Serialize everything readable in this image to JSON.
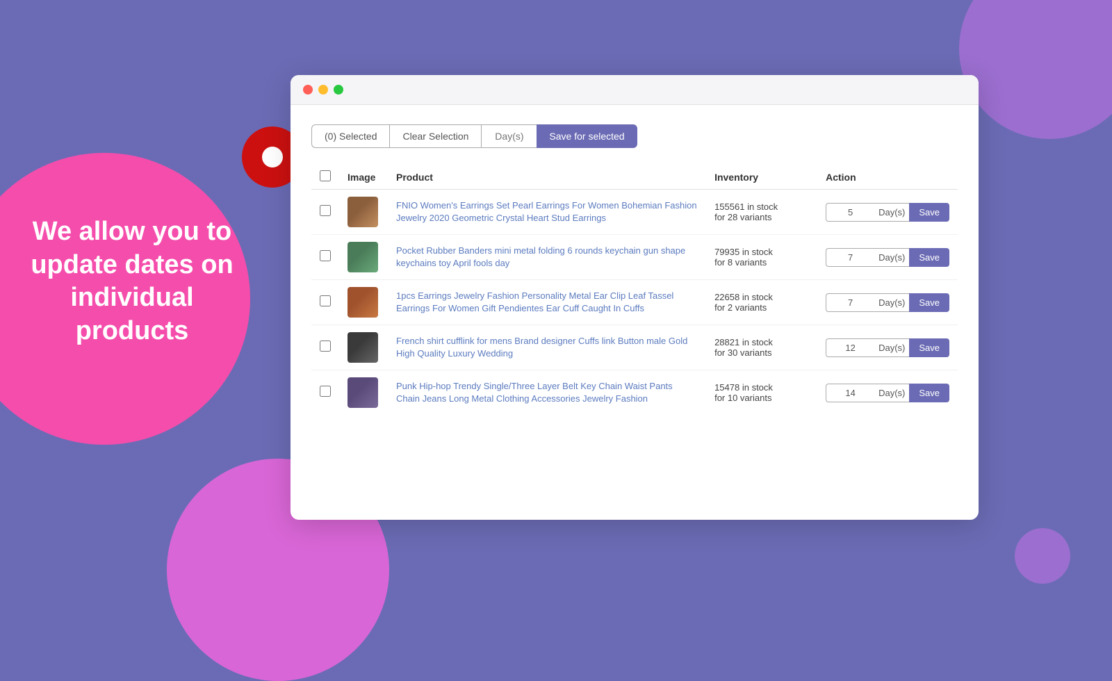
{
  "background": {
    "color": "#6b6bb5"
  },
  "left_text": "We allow you to update dates on individual products",
  "toolbar": {
    "selected_label": "(0) Selected",
    "clear_label": "Clear Selection",
    "days_placeholder": "Day(s)",
    "save_selected_label": "Save for selected"
  },
  "table": {
    "columns": {
      "image": "Image",
      "product": "Product",
      "inventory": "Inventory",
      "action": "Action"
    },
    "rows": [
      {
        "id": 1,
        "product_name": "FNIO Women's Earrings Set Pearl Earrings For Women Bohemian Fashion Jewelry 2020 Geometric Crystal Heart Stud Earrings",
        "inventory_count": "155561 in stock",
        "inventory_variants": "for 28 variants",
        "days_value": "5",
        "img_class": "img-earrings"
      },
      {
        "id": 2,
        "product_name": "Pocket Rubber Banders mini metal folding 6 rounds keychain gun shape keychains toy April fools day",
        "inventory_count": "79935 in stock",
        "inventory_variants": "for 8 variants",
        "days_value": "7",
        "img_class": "img-banders"
      },
      {
        "id": 3,
        "product_name": "1pcs Earrings Jewelry Fashion Personality Metal Ear Clip Leaf Tassel Earrings For Women Gift Pendientes Ear Cuff Caught In Cuffs",
        "inventory_count": "22658 in stock",
        "inventory_variants": "for 2 variants",
        "days_value": "7",
        "img_class": "img-earcuff"
      },
      {
        "id": 4,
        "product_name": "French shirt cufflink for mens Brand designer Cuffs link Button male Gold High Quality Luxury Wedding",
        "inventory_count": "28821 in stock",
        "inventory_variants": "for 30 variants",
        "days_value": "12",
        "img_class": "img-cufflink"
      },
      {
        "id": 5,
        "product_name": "Punk Hip-hop Trendy Single/Three Layer Belt Key Chain Waist Pants Chain Jeans Long Metal Clothing Accessories Jewelry Fashion",
        "inventory_count": "15478 in stock",
        "inventory_variants": "for 10 variants",
        "days_value": "14",
        "img_class": "img-beltchain"
      }
    ]
  }
}
